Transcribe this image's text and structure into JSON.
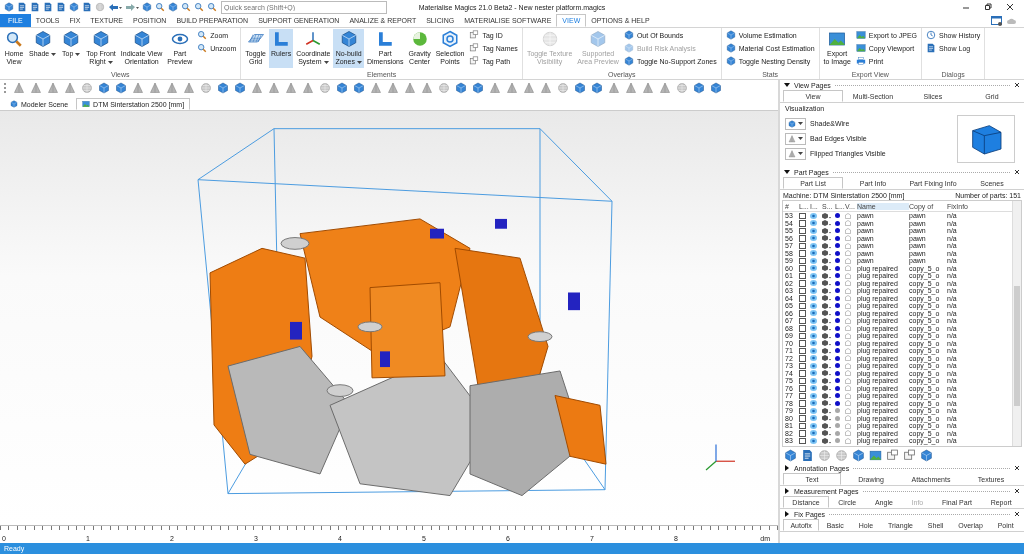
{
  "window": {
    "title": "Materialise Magics 21.0 Beta2 - New nester platform.magics"
  },
  "search": {
    "placeholder": "Quick search (Shift+Q)"
  },
  "tabs": [
    {
      "label": "FILE",
      "kind": "file",
      "selected": false
    },
    {
      "label": "TOOLS",
      "kind": "tab",
      "selected": false
    },
    {
      "label": "FIX",
      "kind": "tab",
      "selected": false
    },
    {
      "label": "TEXTURE",
      "kind": "tab",
      "selected": false
    },
    {
      "label": "POSITION",
      "kind": "tab",
      "selected": false
    },
    {
      "label": "BUILD PREPARATION",
      "kind": "tab",
      "selected": false
    },
    {
      "label": "SUPPORT GENERATION",
      "kind": "tab",
      "selected": false
    },
    {
      "label": "ANALIZE & REPORT",
      "kind": "tab",
      "selected": false
    },
    {
      "label": "SLICING",
      "kind": "tab",
      "selected": false
    },
    {
      "label": "MATERIALISE SOFTWARE",
      "kind": "tab",
      "selected": false
    },
    {
      "label": "VIEW",
      "kind": "tab",
      "selected": true
    },
    {
      "label": "OPTIONS & HELP",
      "kind": "tab",
      "selected": false
    }
  ],
  "ribbon": {
    "groups": [
      {
        "label": "Views",
        "items": [
          {
            "kind": "large",
            "lines": [
              "Home",
              "View"
            ],
            "dropdown": false,
            "selected": false,
            "disabled": false
          },
          {
            "kind": "large",
            "lines": [
              "Shade"
            ],
            "dropdown": true,
            "selected": false,
            "disabled": false
          },
          {
            "kind": "large",
            "lines": [
              "Top"
            ],
            "dropdown": true,
            "selected": false,
            "disabled": false
          },
          {
            "kind": "large",
            "lines": [
              "Top Front",
              "Right"
            ],
            "dropdown": true,
            "selected": false,
            "disabled": false
          },
          {
            "kind": "large",
            "lines": [
              "Indicate View",
              "Orientation"
            ],
            "dropdown": false,
            "selected": false,
            "disabled": false
          },
          {
            "kind": "large",
            "lines": [
              "Part",
              "Preview"
            ],
            "dropdown": false,
            "selected": false,
            "disabled": false
          },
          {
            "kind": "small",
            "lines": [
              "Zoom"
            ],
            "dropdown": false,
            "selected": false,
            "disabled": false
          },
          {
            "kind": "small",
            "lines": [
              "Unzoom"
            ],
            "dropdown": false,
            "selected": false,
            "disabled": false
          }
        ]
      },
      {
        "label": "Elements",
        "items": [
          {
            "kind": "large",
            "lines": [
              "Toggle",
              "Grid"
            ],
            "dropdown": false,
            "selected": false,
            "disabled": false
          },
          {
            "kind": "large",
            "lines": [
              "Rulers"
            ],
            "dropdown": false,
            "selected": true,
            "disabled": false
          },
          {
            "kind": "large",
            "lines": [
              "Coordinate",
              "System"
            ],
            "dropdown": true,
            "selected": false,
            "disabled": false
          },
          {
            "kind": "large",
            "lines": [
              "No-build",
              "Zones"
            ],
            "dropdown": true,
            "selected": true,
            "disabled": false
          },
          {
            "kind": "large",
            "lines": [
              "Part",
              "Dimensions"
            ],
            "dropdown": false,
            "selected": false,
            "disabled": false
          },
          {
            "kind": "large",
            "lines": [
              "Gravity",
              "Center"
            ],
            "dropdown": false,
            "selected": false,
            "disabled": false
          },
          {
            "kind": "large",
            "lines": [
              "Selection",
              "Points"
            ],
            "dropdown": false,
            "selected": false,
            "disabled": false
          },
          {
            "kind": "small",
            "lines": [
              "Tag ID"
            ],
            "dropdown": false,
            "selected": false,
            "disabled": false
          },
          {
            "kind": "small",
            "lines": [
              "Tag Names"
            ],
            "dropdown": false,
            "selected": false,
            "disabled": false
          },
          {
            "kind": "small",
            "lines": [
              "Tag Path"
            ],
            "dropdown": false,
            "selected": false,
            "disabled": false
          }
        ]
      },
      {
        "label": "Overlays",
        "items": [
          {
            "kind": "large",
            "lines": [
              "Toggle Texture",
              "Visibility"
            ],
            "dropdown": false,
            "selected": false,
            "disabled": true
          },
          {
            "kind": "large",
            "lines": [
              "Supported",
              "Area Preview"
            ],
            "dropdown": false,
            "selected": false,
            "disabled": true
          },
          {
            "kind": "small",
            "lines": [
              "Out Of Bounds"
            ],
            "dropdown": false,
            "selected": false,
            "disabled": false
          },
          {
            "kind": "small",
            "lines": [
              "Build Risk Analysis"
            ],
            "dropdown": false,
            "selected": false,
            "disabled": true
          },
          {
            "kind": "small",
            "lines": [
              "Toggle No-Support Zones"
            ],
            "dropdown": false,
            "selected": false,
            "disabled": false
          }
        ]
      },
      {
        "label": "Stats",
        "items": [
          {
            "kind": "small",
            "lines": [
              "Volume Estimation"
            ],
            "dropdown": false,
            "selected": false,
            "disabled": false
          },
          {
            "kind": "small",
            "lines": [
              "Material Cost Estimation"
            ],
            "dropdown": false,
            "selected": false,
            "disabled": false
          },
          {
            "kind": "small",
            "lines": [
              "Toggle Nesting Density"
            ],
            "dropdown": false,
            "selected": false,
            "disabled": false
          }
        ]
      },
      {
        "label": "Export View",
        "items": [
          {
            "kind": "large",
            "lines": [
              "Export",
              "to Image"
            ],
            "dropdown": false,
            "selected": false,
            "disabled": false
          },
          {
            "kind": "small",
            "lines": [
              "Export to JPEG"
            ],
            "dropdown": false,
            "selected": false,
            "disabled": false
          },
          {
            "kind": "small",
            "lines": [
              "Copy Viewport"
            ],
            "dropdown": false,
            "selected": false,
            "disabled": false
          },
          {
            "kind": "small",
            "lines": [
              "Print"
            ],
            "dropdown": false,
            "selected": false,
            "disabled": false
          }
        ]
      },
      {
        "label": "Dialogs",
        "items": [
          {
            "kind": "small",
            "lines": [
              "Show History"
            ],
            "dropdown": false,
            "selected": false,
            "disabled": false
          },
          {
            "kind": "small",
            "lines": [
              "Show Log"
            ],
            "dropdown": false,
            "selected": false,
            "disabled": false
          }
        ]
      }
    ]
  },
  "document_tabs": [
    {
      "label": "Modeler Scene",
      "selected": false
    },
    {
      "label": "DTM Sinterstation 2500 [mm]",
      "selected": true
    }
  ],
  "ruler": {
    "ticks": [
      "0",
      "1",
      "2",
      "3",
      "4",
      "5",
      "6",
      "7",
      "8"
    ],
    "unit": "dm"
  },
  "view_pages": {
    "title": "View Pages",
    "expanded": true,
    "tabs": [
      {
        "label": "View",
        "selected": true
      },
      {
        "label": "Multi-Section",
        "selected": false
      },
      {
        "label": "Slices",
        "selected": false
      },
      {
        "label": "Grid",
        "selected": false
      }
    ],
    "visualization": {
      "label": "Visualization",
      "options": [
        {
          "label": "Shade&Wire"
        },
        {
          "label": "Bad Edges Visible"
        },
        {
          "label": "Flipped Triangles Visible"
        }
      ]
    }
  },
  "part_pages": {
    "title": "Part Pages",
    "expanded": true,
    "tabs": [
      {
        "label": "Part List",
        "selected": true
      },
      {
        "label": "Part Info",
        "selected": false
      },
      {
        "label": "Part Fixing Info",
        "selected": false
      },
      {
        "label": "Scenes",
        "selected": false
      }
    ],
    "machine": "Machine: DTM Sinterstation 2500 [mm]",
    "count": "Number of parts: 151",
    "columns": [
      {
        "label": "#",
        "sorted": false
      },
      {
        "label": "L...",
        "sorted": false
      },
      {
        "label": "I...",
        "sorted": false
      },
      {
        "label": "S...",
        "sorted": false
      },
      {
        "label": "L...",
        "sorted": false
      },
      {
        "label": "V...",
        "sorted": false
      },
      {
        "label": "Name",
        "sorted": true
      },
      {
        "label": "Copy of",
        "sorted": false
      },
      {
        "label": "FixInfo",
        "sorted": false
      }
    ],
    "rows": [
      {
        "n": "53",
        "checked": false,
        "color": "#1010c8",
        "name": "pawn",
        "copy_of": "pawn",
        "fix_info": "n/a"
      },
      {
        "n": "54",
        "checked": false,
        "color": "#1010c8",
        "name": "pawn",
        "copy_of": "pawn",
        "fix_info": "n/a"
      },
      {
        "n": "55",
        "checked": false,
        "color": "#1010c8",
        "name": "pawn",
        "copy_of": "pawn",
        "fix_info": "n/a"
      },
      {
        "n": "56",
        "checked": false,
        "color": "#1010c8",
        "name": "pawn",
        "copy_of": "pawn",
        "fix_info": "n/a"
      },
      {
        "n": "57",
        "checked": false,
        "color": "#1010c8",
        "name": "pawn",
        "copy_of": "pawn",
        "fix_info": "n/a"
      },
      {
        "n": "58",
        "checked": false,
        "color": "#1010c8",
        "name": "pawn",
        "copy_of": "pawn",
        "fix_info": "n/a"
      },
      {
        "n": "59",
        "checked": false,
        "color": "#1010c8",
        "name": "pawn",
        "copy_of": "pawn",
        "fix_info": "n/a"
      },
      {
        "n": "60",
        "checked": false,
        "color": "#1010c8",
        "name": "plug repaired",
        "copy_of": "copy_5_o",
        "fix_info": "n/a"
      },
      {
        "n": "61",
        "checked": false,
        "color": "#1010c8",
        "name": "plug repaired",
        "copy_of": "copy_5_o",
        "fix_info": "n/a"
      },
      {
        "n": "62",
        "checked": false,
        "color": "#1010c8",
        "name": "plug repaired",
        "copy_of": "copy_5_o",
        "fix_info": "n/a"
      },
      {
        "n": "63",
        "checked": false,
        "color": "#1010c8",
        "name": "plug repaired",
        "copy_of": "copy_5_o",
        "fix_info": "n/a"
      },
      {
        "n": "64",
        "checked": false,
        "color": "#1010c8",
        "name": "plug repaired",
        "copy_of": "copy_5_o",
        "fix_info": "n/a"
      },
      {
        "n": "65",
        "checked": false,
        "color": "#1010c8",
        "name": "plug repaired",
        "copy_of": "copy_5_o",
        "fix_info": "n/a"
      },
      {
        "n": "66",
        "checked": false,
        "color": "#1010c8",
        "name": "plug repaired",
        "copy_of": "copy_5_o",
        "fix_info": "n/a"
      },
      {
        "n": "67",
        "checked": false,
        "color": "#1010c8",
        "name": "plug repaired",
        "copy_of": "copy_5_o",
        "fix_info": "n/a"
      },
      {
        "n": "68",
        "checked": false,
        "color": "#1010c8",
        "name": "plug repaired",
        "copy_of": "copy_5_o",
        "fix_info": "n/a"
      },
      {
        "n": "69",
        "checked": false,
        "color": "#1010c8",
        "name": "plug repaired",
        "copy_of": "copy_5_o",
        "fix_info": "n/a"
      },
      {
        "n": "70",
        "checked": false,
        "color": "#1010c8",
        "name": "plug repaired",
        "copy_of": "copy_5_o",
        "fix_info": "n/a"
      },
      {
        "n": "71",
        "checked": false,
        "color": "#1010c8",
        "name": "plug repaired",
        "copy_of": "copy_5_o",
        "fix_info": "n/a"
      },
      {
        "n": "72",
        "checked": false,
        "color": "#1010c8",
        "name": "plug repaired",
        "copy_of": "copy_5_o",
        "fix_info": "n/a"
      },
      {
        "n": "73",
        "checked": false,
        "color": "#1010c8",
        "name": "plug repaired",
        "copy_of": "copy_5_o",
        "fix_info": "n/a"
      },
      {
        "n": "74",
        "checked": false,
        "color": "#1010c8",
        "name": "plug repaired",
        "copy_of": "copy_5_o",
        "fix_info": "n/a"
      },
      {
        "n": "75",
        "checked": false,
        "color": "#1010c8",
        "name": "plug repaired",
        "copy_of": "copy_5_o",
        "fix_info": "n/a"
      },
      {
        "n": "76",
        "checked": false,
        "color": "#1010c8",
        "name": "plug repaired",
        "copy_of": "copy_5_o",
        "fix_info": "n/a"
      },
      {
        "n": "77",
        "checked": false,
        "color": "#1010c8",
        "name": "plug repaired",
        "copy_of": "copy_5_o",
        "fix_info": "n/a"
      },
      {
        "n": "78",
        "checked": false,
        "color": "#1010c8",
        "name": "plug repaired",
        "copy_of": "copy_5_o",
        "fix_info": "n/a"
      },
      {
        "n": "79",
        "checked": false,
        "color": "#a8a8a8",
        "name": "plug repaired",
        "copy_of": "copy_5_o",
        "fix_info": "n/a"
      },
      {
        "n": "80",
        "checked": false,
        "color": "#a8a8a8",
        "name": "plug repaired",
        "copy_of": "copy_5_o",
        "fix_info": "n/a"
      },
      {
        "n": "81",
        "checked": false,
        "color": "#a8a8a8",
        "name": "plug repaired",
        "copy_of": "copy_5_o",
        "fix_info": "n/a"
      },
      {
        "n": "82",
        "checked": false,
        "color": "#a8a8a8",
        "name": "plug repaired",
        "copy_of": "copy_5_o",
        "fix_info": "n/a"
      },
      {
        "n": "83",
        "checked": false,
        "color": "#a8a8a8",
        "name": "plug repaired",
        "copy_of": "copy_5_o",
        "fix_info": "n/a"
      }
    ]
  },
  "collapsed_pages": [
    {
      "title": "Annotation Pages",
      "expanded": false,
      "tabs": [
        {
          "label": "Text",
          "selected": true,
          "disabled": false
        },
        {
          "label": "Drawing",
          "selected": false,
          "disabled": false
        },
        {
          "label": "Attachments",
          "selected": false,
          "disabled": false
        },
        {
          "label": "Textures",
          "selected": false,
          "disabled": false
        }
      ]
    },
    {
      "title": "Measurement Pages",
      "expanded": false,
      "tabs": [
        {
          "label": "Distance",
          "selected": true,
          "disabled": false
        },
        {
          "label": "Circle",
          "selected": false,
          "disabled": false
        },
        {
          "label": "Angle",
          "selected": false,
          "disabled": false
        },
        {
          "label": "Info",
          "selected": false,
          "disabled": true
        },
        {
          "label": "Final Part",
          "selected": false,
          "disabled": false
        },
        {
          "label": "Report",
          "selected": false,
          "disabled": false
        }
      ]
    },
    {
      "title": "Fix Pages",
      "expanded": false,
      "tabs": [
        {
          "label": "Autofix",
          "selected": true,
          "disabled": false
        },
        {
          "label": "Basic",
          "selected": false,
          "disabled": false
        },
        {
          "label": "Hole",
          "selected": false,
          "disabled": false
        },
        {
          "label": "Triangle",
          "selected": false,
          "disabled": false
        },
        {
          "label": "Shell",
          "selected": false,
          "disabled": false
        },
        {
          "label": "Overlap",
          "selected": false,
          "disabled": false
        },
        {
          "label": "Point",
          "selected": false,
          "disabled": false
        }
      ]
    }
  ],
  "status_bar": {
    "text": "Ready"
  }
}
